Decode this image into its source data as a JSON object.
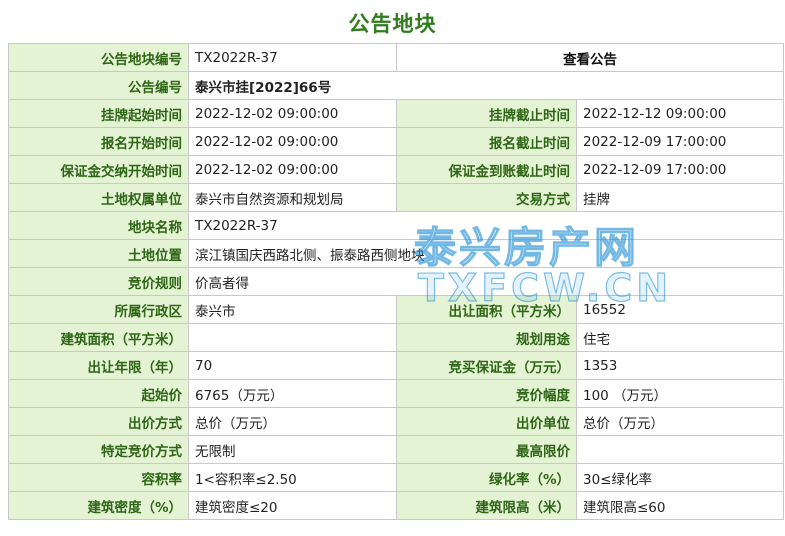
{
  "title": "公告地块",
  "rows": [
    {
      "l1": "公告地块编号",
      "v1": "TX2022R-37",
      "link": "查看公告"
    },
    {
      "l1": "公告编号",
      "v1": "泰兴市挂[2022]66号"
    },
    {
      "l1": "挂牌起始时间",
      "v1": "2022-12-02 09:00:00",
      "l2": "挂牌截止时间",
      "v2": "2022-12-12 09:00:00"
    },
    {
      "l1": "报名开始时间",
      "v1": "2022-12-02 09:00:00",
      "l2": "报名截止时间",
      "v2": "2022-12-09 17:00:00"
    },
    {
      "l1": "保证金交纳开始时间",
      "v1": "2022-12-02 09:00:00",
      "l2": "保证金到账截止时间",
      "v2": "2022-12-09 17:00:00"
    },
    {
      "l1": "土地权属单位",
      "v1": "泰兴市自然资源和规划局",
      "l2": "交易方式",
      "v2": "挂牌"
    },
    {
      "l1": "地块名称",
      "v1": "TX2022R-37"
    },
    {
      "l1": "土地位置",
      "v1": "滨江镇国庆西路北侧、振泰路西侧地块"
    },
    {
      "l1": "竞价规则",
      "v1": "价高者得"
    },
    {
      "l1": "所属行政区",
      "v1": "泰兴市",
      "l2": "出让面积（平方米）",
      "v2": "16552"
    },
    {
      "l1": "建筑面积（平方米）",
      "v1": "",
      "l2": "规划用途",
      "v2": "住宅"
    },
    {
      "l1": "出让年限（年）",
      "v1": "70",
      "l2": "竞买保证金（万元）",
      "v2": "1353"
    },
    {
      "l1": "起始价",
      "v1": "6765（万元）",
      "l2": "竞价幅度",
      "v2": "100 （万元）"
    },
    {
      "l1": "出价方式",
      "v1": "总价（万元）",
      "l2": "出价单位",
      "v2": "总价（万元）"
    },
    {
      "l1": "特定竞价方式",
      "v1": "无限制",
      "l2": "最高限价",
      "v2": ""
    },
    {
      "l1": "容积率",
      "v1": "1<容积率≤2.50",
      "l2": "绿化率（%）",
      "v2": "30≤绿化率"
    },
    {
      "l1": "建筑密度（%）",
      "v1": "建筑密度≤20",
      "l2": "建筑限高（米）",
      "v2": "建筑限高≤60"
    }
  ],
  "watermark": {
    "line1": "泰兴房产网",
    "line2": "TXFCW.CN"
  }
}
